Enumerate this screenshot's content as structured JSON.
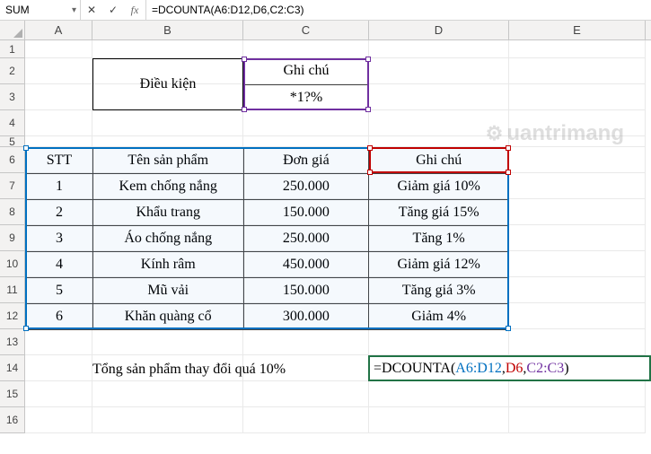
{
  "name_box": "SUM",
  "formula": "=DCOUNTA(A6:D12,D6,C2:C3)",
  "columns": [
    "A",
    "B",
    "C",
    "D",
    "E"
  ],
  "row_numbers": [
    "1",
    "2",
    "3",
    "4",
    "5",
    "6",
    "7",
    "8",
    "9",
    "10",
    "11",
    "12",
    "13",
    "14",
    "15",
    "16"
  ],
  "criteria": {
    "label": "Điều kiện",
    "header": "Ghi chú",
    "value": "*1?%"
  },
  "table": {
    "headers": [
      "STT",
      "Tên sản phẩm",
      "Đơn giá",
      "Ghi chú"
    ],
    "rows": [
      [
        "1",
        "Kem chống nắng",
        "250.000",
        "Giảm giá 10%"
      ],
      [
        "2",
        "Khẩu trang",
        "150.000",
        "Tăng giá 15%"
      ],
      [
        "3",
        "Áo chống nắng",
        "250.000",
        "Tăng 1%"
      ],
      [
        "4",
        "Kính râm",
        "450.000",
        "Giảm giá 12%"
      ],
      [
        "5",
        "Mũ vải",
        "150.000",
        "Tăng giá 3%"
      ],
      [
        "6",
        "Khăn quàng cổ",
        "300.000",
        "Giảm 4%"
      ]
    ]
  },
  "summary_label": "Tổng sản phẩm thay đổi quá 10%",
  "active_formula": {
    "prefix": "=DCOUNTA(",
    "arg1": "A6:D12",
    "arg2": "D6",
    "arg3": "C2:C3",
    "suffix": ")"
  },
  "watermark": "uantrimang"
}
